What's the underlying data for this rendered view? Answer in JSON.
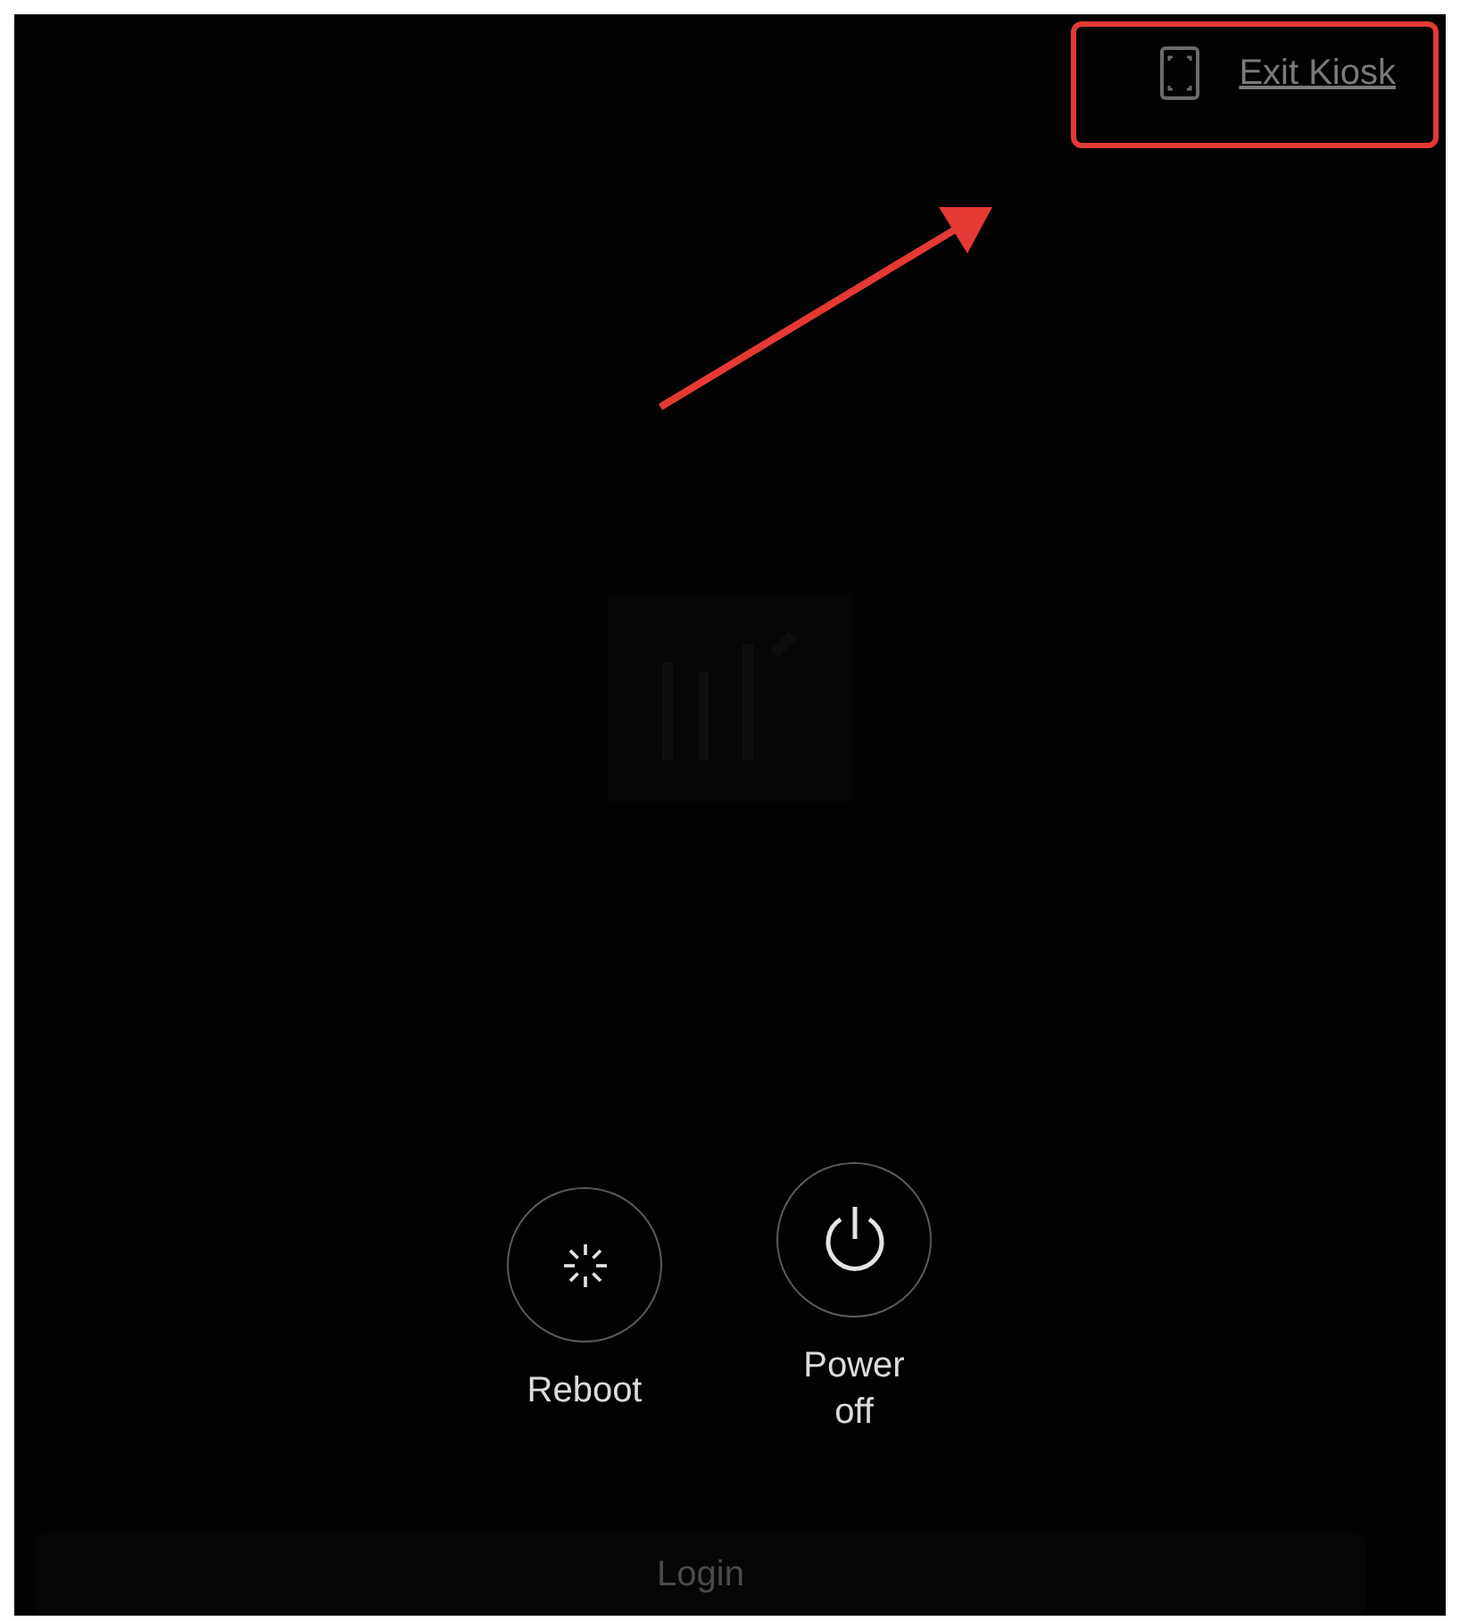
{
  "header": {
    "exit_link": "Exit Kiosk"
  },
  "actions": [
    {
      "label": "Reboot",
      "kind": "reboot"
    },
    {
      "label": "Power off",
      "kind": "power"
    }
  ],
  "login_button": "Login"
}
